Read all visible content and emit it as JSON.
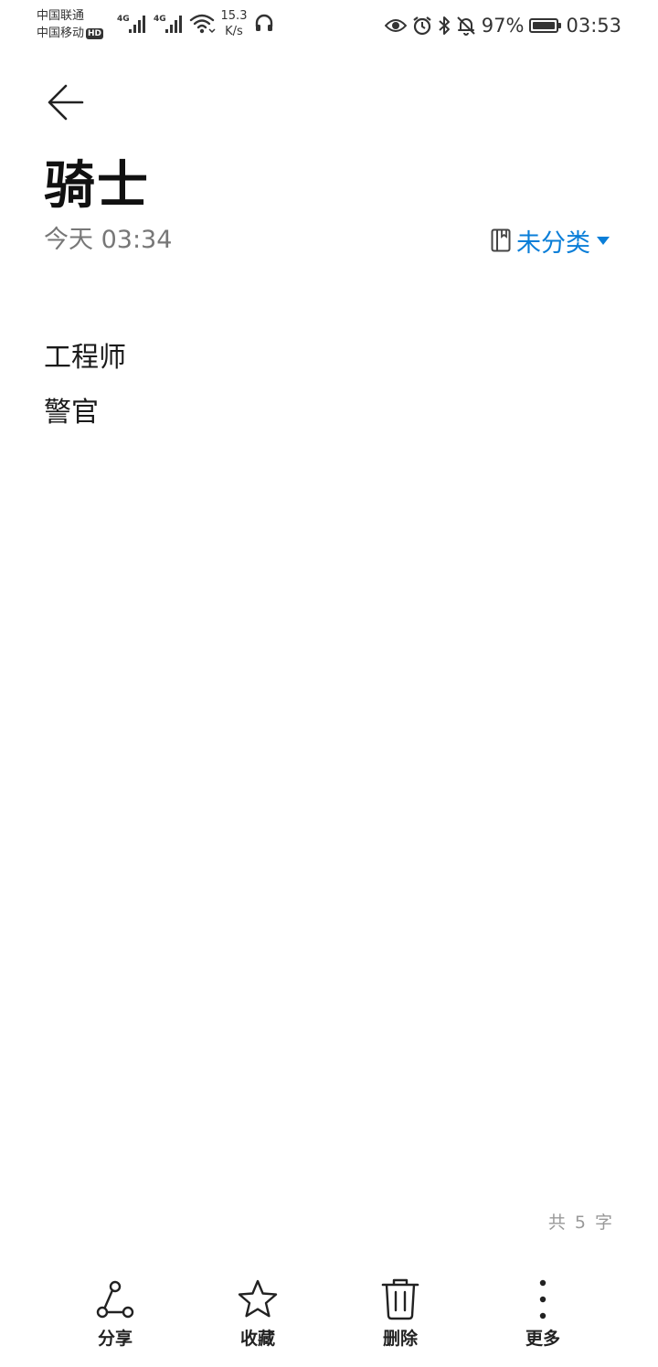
{
  "status_bar": {
    "carrier_1": "中国联通",
    "carrier_2": "中国移动",
    "hd_badge": "HD",
    "signal_label_1": "4G",
    "signal_label_2": "4G",
    "net_speed_value": "15.3",
    "net_speed_unit": "K/s",
    "battery_percent": "97%",
    "time": "03:53"
  },
  "note": {
    "title": "骑士",
    "modified_time": "今天 03:34",
    "category": "未分类",
    "lines": [
      "工程师",
      "警官"
    ],
    "word_count": "共 5 字"
  },
  "toolbar": {
    "share_label": "分享",
    "favorite_label": "收藏",
    "delete_label": "删除",
    "more_label": "更多"
  },
  "colors": {
    "accent": "#0a7ed8",
    "text_primary": "#1a1a1a",
    "text_secondary": "#777777",
    "text_hint": "#999999"
  },
  "icons": {
    "back": "arrow-left-icon",
    "category": "notebook-icon",
    "dropdown": "triangle-down-icon",
    "share": "share-icon",
    "favorite": "star-icon",
    "delete": "trash-icon",
    "more": "more-vertical-icon"
  }
}
